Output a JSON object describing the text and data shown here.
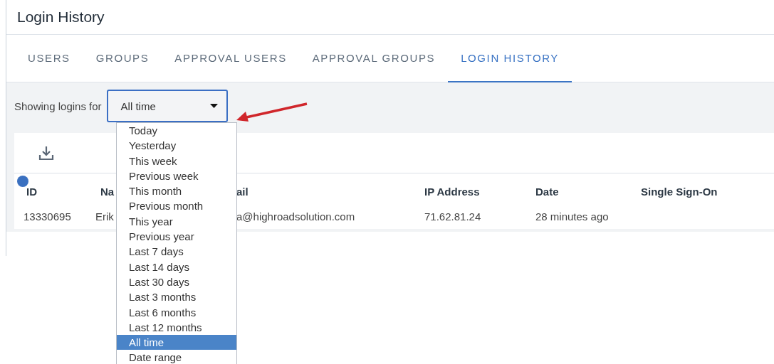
{
  "page": {
    "title": "Login History"
  },
  "tabs": [
    {
      "label": "USERS",
      "selected": false
    },
    {
      "label": "GROUPS",
      "selected": false
    },
    {
      "label": "APPROVAL USERS",
      "selected": false
    },
    {
      "label": "APPROVAL GROUPS",
      "selected": false
    },
    {
      "label": "LOGIN HISTORY",
      "selected": true
    }
  ],
  "filter": {
    "label": "Showing logins for",
    "value": "All time",
    "expanded": true,
    "options": [
      {
        "label": "Today",
        "selected": false
      },
      {
        "label": "Yesterday",
        "selected": false
      },
      {
        "label": "This week",
        "selected": false
      },
      {
        "label": "Previous week",
        "selected": false
      },
      {
        "label": "This month",
        "selected": false
      },
      {
        "label": "Previous month",
        "selected": false
      },
      {
        "label": "This year",
        "selected": false
      },
      {
        "label": "Previous year",
        "selected": false
      },
      {
        "label": "Last 7 days",
        "selected": false
      },
      {
        "label": "Last 14 days",
        "selected": false
      },
      {
        "label": "Last 30 days",
        "selected": false
      },
      {
        "label": "Last 3 months",
        "selected": false
      },
      {
        "label": "Last 6 months",
        "selected": false
      },
      {
        "label": "Last 12 months",
        "selected": false
      },
      {
        "label": "All time",
        "selected": true
      },
      {
        "label": "Date range",
        "selected": false
      }
    ]
  },
  "table": {
    "columns": [
      "ID",
      "Na",
      "ail",
      "IP Address",
      "Date",
      "Single Sign-On"
    ],
    "rows": [
      [
        "13330695",
        "Erik",
        "a@highroadsolution.com",
        "71.62.81.24",
        "28 minutes ago",
        ""
      ]
    ]
  }
}
